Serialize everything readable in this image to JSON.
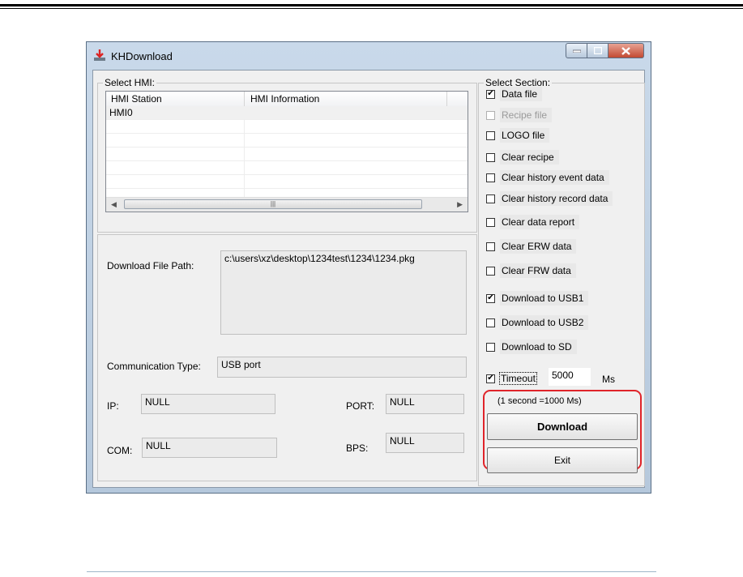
{
  "window": {
    "title": "KHDownload"
  },
  "hmi_group": {
    "label": "Select HMI:",
    "columns": [
      "HMI Station",
      "HMI Information"
    ],
    "rows": [
      {
        "station": "HMI0",
        "info": ""
      }
    ]
  },
  "info_group": {
    "download_path_label": "Download File Path:",
    "download_path_value": "c:\\users\\xz\\desktop\\1234test\\1234\\1234.pkg",
    "comm_type_label": "Communication Type:",
    "comm_type_value": "USB port",
    "ip_label": "IP:",
    "ip_value": "NULL",
    "port_label": "PORT:",
    "port_value": "NULL",
    "com_label": "COM:",
    "com_value": "NULL",
    "bps_label": "BPS:",
    "bps_value": "NULL"
  },
  "section_group": {
    "label": "Select Section:",
    "items": [
      {
        "label": "Data file",
        "checked": true,
        "enabled": true
      },
      {
        "label": "Recipe file",
        "checked": false,
        "enabled": false
      },
      {
        "label": "LOGO file",
        "checked": false,
        "enabled": true
      },
      {
        "label": "Clear recipe",
        "checked": false,
        "enabled": true
      },
      {
        "label": "Clear history event data",
        "checked": false,
        "enabled": true
      },
      {
        "label": "Clear history record data",
        "checked": false,
        "enabled": true
      },
      {
        "label": "Clear data report",
        "checked": false,
        "enabled": true
      },
      {
        "label": "Clear ERW data",
        "checked": false,
        "enabled": true
      },
      {
        "label": "Clear FRW data",
        "checked": false,
        "enabled": true
      },
      {
        "label": "Download to USB1",
        "checked": true,
        "enabled": true
      },
      {
        "label": "Download to USB2",
        "checked": false,
        "enabled": true
      },
      {
        "label": "Download to SD",
        "checked": false,
        "enabled": true
      }
    ],
    "timeout_label": "Timeout",
    "timeout_checked": true,
    "timeout_value": "5000",
    "timeout_unit": "Ms",
    "timeout_note": "(1 second =1000 Ms)",
    "download_button": "Download",
    "exit_button": "Exit"
  },
  "colors": {
    "highlight_border": "#e0242a",
    "title_close": "#c24a32"
  }
}
